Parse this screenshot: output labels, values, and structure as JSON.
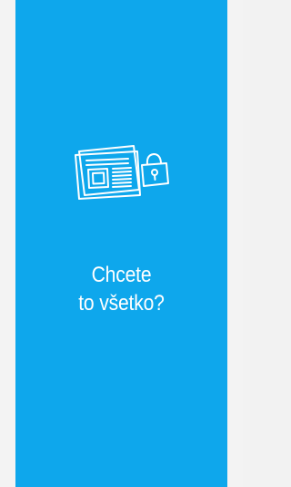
{
  "promo": {
    "headline_line1": "Chcete",
    "headline_line2": "to všetko?",
    "icon": "newspaper-lock-icon",
    "colors": {
      "panel": "#0ea7ec",
      "background": "#f3f3f3",
      "text": "#ffffff"
    }
  }
}
